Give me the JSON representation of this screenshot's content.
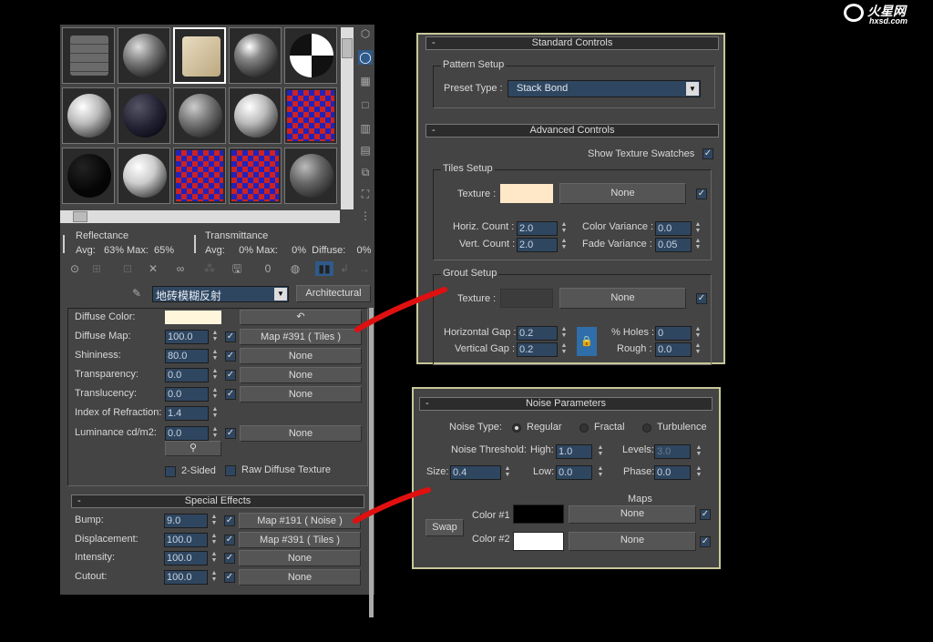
{
  "logo": {
    "brand": "火星网",
    "site": "hxsd.com"
  },
  "browser": {
    "stats": {
      "reflectance_label": "Reflectance",
      "refl_avg": "Avg:   63% Max:  65%",
      "transmittance_label": "Transmittance",
      "trans_line": "Avg:     0% Max:     0%  Diffuse:    0%"
    },
    "material_name": "地砖模糊反射",
    "material_type": "Architectural",
    "params": [
      {
        "label": "Diffuse Color:",
        "color": "#fff6dc"
      },
      {
        "label": "Diffuse Map:",
        "value": "100.0",
        "checked": true,
        "map": "Map #391  ( Tiles )"
      },
      {
        "label": "Shininess:",
        "value": "80.0",
        "checked": true,
        "map": "None"
      },
      {
        "label": "Transparency:",
        "value": "0.0",
        "checked": true,
        "map": "None"
      },
      {
        "label": "Translucency:",
        "value": "0.0",
        "checked": true,
        "map": "None"
      },
      {
        "label": "Index of Refraction:",
        "value": "1.4"
      },
      {
        "label": "Luminance cd/m2:",
        "value": "0.0",
        "checked": true,
        "map": "None"
      }
    ],
    "two_sided": "2-Sided",
    "raw_diffuse": "Raw Diffuse Texture",
    "special_effects": {
      "title": "Special Effects",
      "collapse": "-",
      "rows": [
        {
          "label": "Bump:",
          "value": "9.0",
          "map": "Map #191  ( Noise )"
        },
        {
          "label": "Displacement:",
          "value": "100.0",
          "map": "Map #391  ( Tiles )"
        },
        {
          "label": "Intensity:",
          "value": "100.0",
          "map": "None"
        },
        {
          "label": "Cutout:",
          "value": "100.0",
          "map": "None"
        }
      ]
    }
  },
  "tiles": {
    "standard": {
      "title": "Standard Controls",
      "collapse": "-",
      "pattern_setup": "Pattern Setup",
      "preset_label": "Preset Type :",
      "preset_value": "Stack Bond"
    },
    "advanced": {
      "title": "Advanced Controls",
      "collapse": "-",
      "show_swatches": "Show Texture Swatches",
      "tiles_setup": "Tiles Setup",
      "texture_label": "Texture :",
      "texture_color": "#ffe8c8",
      "texture_map": "None",
      "horiz_label": "Horiz. Count :",
      "horiz": "2.0",
      "vert_label": "Vert. Count :",
      "vert": "2.0",
      "color_var_label": "Color Variance :",
      "color_var": "0.0",
      "fade_var_label": "Fade Variance :",
      "fade_var": "0.05",
      "grout_setup": "Grout Setup",
      "grout_texture_label": "Texture :",
      "grout_texture_map": "None",
      "hgap_label": "Horizontal Gap :",
      "hgap": "0.2",
      "vgap_label": "Vertical Gap :",
      "vgap": "0.2",
      "holes_label": "% Holes :",
      "holes": "0",
      "rough_label": "Rough :",
      "rough": "0.0"
    }
  },
  "noise": {
    "title": "Noise Parameters",
    "collapse": "-",
    "type_label": "Noise Type:",
    "types": [
      "Regular",
      "Fractal",
      "Turbulence"
    ],
    "selected": "Regular",
    "threshold_label": "Noise Threshold:",
    "high_label": "High:",
    "high": "1.0",
    "levels_label": "Levels:",
    "levels": "3.0",
    "size_label": "Size:",
    "size": "0.4",
    "low_label": "Low:",
    "low": "0.0",
    "phase_label": "Phase:",
    "phase": "0.0",
    "maps_label": "Maps",
    "swap": "Swap",
    "color1_label": "Color #1",
    "color1": "#000000",
    "color1_map": "None",
    "color2_label": "Color #2",
    "color2": "#ffffff",
    "color2_map": "None"
  },
  "colors": {
    "panel": "#444444",
    "spinner": "#2f4660",
    "highlight_border": "#c8c89a",
    "annotation": "#e01010"
  }
}
